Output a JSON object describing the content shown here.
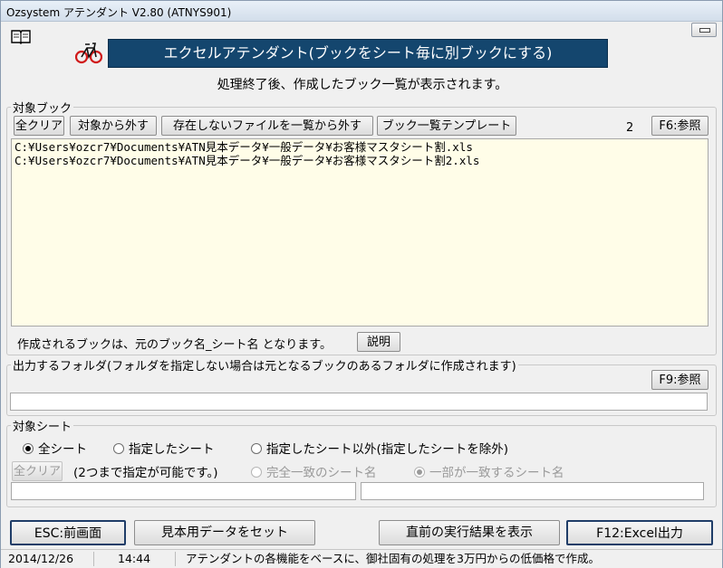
{
  "window": {
    "title": "Ozsystem アテンダント V2.80 (ATNYS901)"
  },
  "header": {
    "banner": "エクセルアテンダント(ブックをシート毎に別ブックにする)",
    "subtitle": "処理終了後、作成したブック一覧が表示されます。"
  },
  "books": {
    "legend": "対象ブック",
    "buttons": {
      "clear": "全クリア",
      "remove": "対象から外す",
      "remove_missing": "存在しないファイルを一覧から外す",
      "template": "ブック一覧テンプレート",
      "browse": "F6:参照"
    },
    "count": "2",
    "files": [
      "C:¥Users¥ozcr7¥Documents¥ATN見本データ¥一般データ¥お客様マスタシート割.xls",
      "C:¥Users¥ozcr7¥Documents¥ATN見本データ¥一般データ¥お客様マスタシート割2.xls"
    ],
    "note": "作成されるブックは、元のブック名_シート名 となります。",
    "explain_button": "説明"
  },
  "output": {
    "legend": "出力するフォルダ(フォルダを指定しない場合は元となるブックのあるフォルダに作成されます)",
    "browse": "F9:参照",
    "folder_value": ""
  },
  "sheets": {
    "legend": "対象シート",
    "options": [
      "全シート",
      "指定したシート",
      "指定したシート以外(指定したシートを除外)"
    ],
    "selected": "全シート",
    "clear": "全クリア",
    "hint": "(2つまで指定が可能です。)",
    "match_options": [
      "完全一致のシート名",
      "一部が一致するシート名"
    ],
    "match_selected": "一部が一致するシート名",
    "sheet1_value": "",
    "sheet2_value": ""
  },
  "footer": {
    "esc": "ESC:前画面",
    "sample": "見本用データをセット",
    "last_result": "直前の実行結果を表示",
    "run": "F12:Excel出力"
  },
  "status": {
    "date": "2014/12/26",
    "time": "14:44",
    "message": "アテンダントの各機能をベースに、御社固有の処理を3万円からの低価格で作成。"
  }
}
